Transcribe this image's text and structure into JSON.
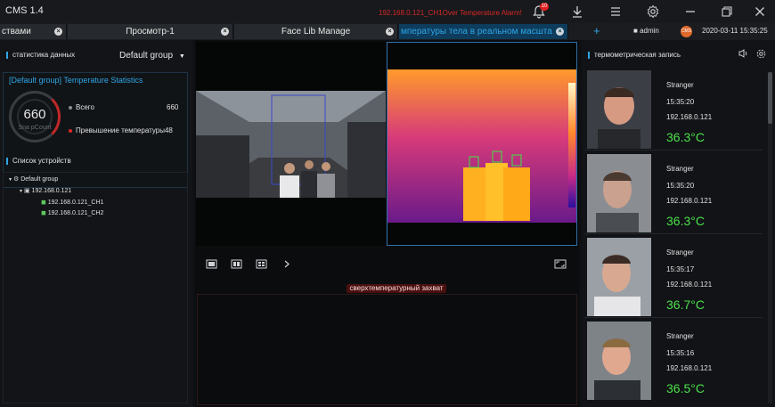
{
  "app": {
    "title": "CMS 1.4",
    "alarm_text": "192.168.0.121_CH1Over Temperature Alarm!",
    "alarm_count": "10"
  },
  "tabs": [
    {
      "label": "ствами"
    },
    {
      "label": "Просмотр-1"
    },
    {
      "label": "Face Lib Manage"
    },
    {
      "label": "мпературы тела в реальном масшта"
    }
  ],
  "header": {
    "user": "admin",
    "logo": "CMS",
    "datetime": "2020-03-11 15:35:25"
  },
  "left": {
    "stats_title": "статистика данных",
    "group_select": "Default group",
    "stats_box_title": "[Default group] Temperature Statistics",
    "gauge_value": "660",
    "gauge_unit": "Sna pCount",
    "total_label": "Всего",
    "total_value": "660",
    "over_label": "Превышение температуры",
    "over_value": "48",
    "devices_title": "Список устройств",
    "tree": [
      "Default group",
      "192.168.0.121",
      "192.168.0.121_CH1",
      "192.168.0.121_CH2"
    ]
  },
  "center": {
    "alarm_label": "сверхтемпературный захват"
  },
  "right": {
    "title": "термометрическая запись",
    "records": [
      {
        "name": "Stranger",
        "time": "15:35:20",
        "ip": "192.168.0.121",
        "temp": "36.3°C"
      },
      {
        "name": "Stranger",
        "time": "15:35:20",
        "ip": "192.168.0.121",
        "temp": "36.3°C"
      },
      {
        "name": "Stranger",
        "time": "15:35:17",
        "ip": "192.168.0.121",
        "temp": "36.7°C"
      },
      {
        "name": "Stranger",
        "time": "15:35:16",
        "ip": "192.168.0.121",
        "temp": "36.5°C"
      }
    ]
  },
  "colors": {
    "accent": "#2ea6e6",
    "alarm": "#d72828",
    "temp_ok": "#4be04b"
  }
}
